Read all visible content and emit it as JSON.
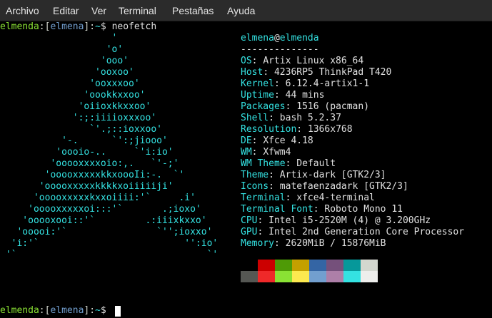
{
  "menubar": {
    "items": [
      "Archivo",
      "Editar",
      "Ver",
      "Terminal",
      "Pestañas",
      "Ayuda"
    ]
  },
  "prompt": {
    "user": "elmenda",
    "colon": ":",
    "host_open": "[",
    "host": "elmena",
    "host_close": "]",
    "colon2": ":",
    "path": "~",
    "dollar": "$",
    "command": "neofetch"
  },
  "logo_lines": [
    "                    '",
    "                   'o'",
    "                  'ooo'",
    "                 'ooxoo'",
    "                'ooxxxoo'",
    "               'oookkxxoo'",
    "              'oiioxkkxxoo'",
    "             ':;:iiiioxxxoo'",
    "                `'.;::ioxxoo'",
    "           '-.      `':;jiooo'",
    "          'oooio-..     `'i:io'",
    "         'ooooxxxxoio:,.   `'-;'",
    "        'ooooxxxxxkkxoooIi:-.  `'",
    "       'ooooxxxxxkkkkxoiiiiiji'",
    "      'ooooxxxxxkxxoiiii:'`     .i'",
    "     'ooooxxxxxoi:::'`       .;ioxo'",
    "    'ooooxooi::'`         .:iiixkxxo'",
    "   'ooooi:'`                `'';ioxxo'",
    "  'i:'`                          '':io'",
    " '`                                  `'"
  ],
  "info": {
    "title_user": "elmena",
    "title_at": "@",
    "title_host": "elmenda",
    "separator": "--------------",
    "rows": [
      {
        "key": "OS",
        "value": "Artix Linux x86_64"
      },
      {
        "key": "Host",
        "value": "4236RP5 ThinkPad T420"
      },
      {
        "key": "Kernel",
        "value": "6.12.4-artix1-1"
      },
      {
        "key": "Uptime",
        "value": "44 mins"
      },
      {
        "key": "Packages",
        "value": "1516 (pacman)"
      },
      {
        "key": "Shell",
        "value": "bash 5.2.37"
      },
      {
        "key": "Resolution",
        "value": "1366x768"
      },
      {
        "key": "DE",
        "value": "Xfce 4.18"
      },
      {
        "key": "WM",
        "value": "Xfwm4"
      },
      {
        "key": "WM Theme",
        "value": "Default"
      },
      {
        "key": "Theme",
        "value": "Artix-dark [GTK2/3]"
      },
      {
        "key": "Icons",
        "value": "matefaenzadark [GTK2/3]"
      },
      {
        "key": "Terminal",
        "value": "xfce4-terminal"
      },
      {
        "key": "Terminal Font",
        "value": "Roboto Mono 11"
      },
      {
        "key": "CPU",
        "value": "Intel i5-2520M (4) @ 3.200GHz"
      },
      {
        "key": "GPU",
        "value": "Intel 2nd Generation Core Processor"
      },
      {
        "key": "Memory",
        "value": "2620MiB / 15876MiB"
      }
    ],
    "key_suffix": ":"
  },
  "palette": {
    "dark": [
      "#000000",
      "#cc0000",
      "#4e9a06",
      "#c4a000",
      "#3465a4",
      "#75507b",
      "#06989a",
      "#d3d7cf"
    ],
    "bright": [
      "#555753",
      "#ef2929",
      "#8ae234",
      "#fce94f",
      "#729fcf",
      "#ad7fa8",
      "#34e2e2",
      "#eeeeec"
    ]
  },
  "prompt2": {
    "user": "elmenda",
    "colon": ":",
    "host_open": "[",
    "host": "elmena",
    "host_close": "]",
    "colon2": ":",
    "path": "~",
    "dollar": "$"
  }
}
